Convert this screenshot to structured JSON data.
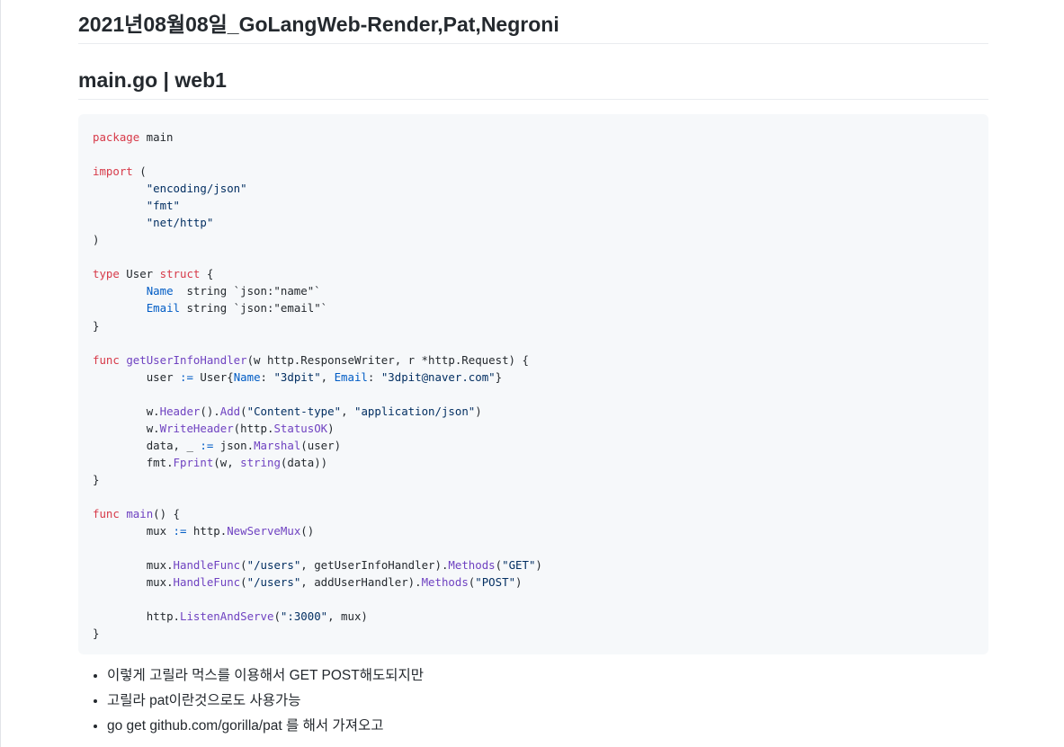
{
  "document": {
    "title": "2021년08월08일_GoLangWeb-Render,Pat,Negroni",
    "section_title": "main.go | web1"
  },
  "code": {
    "language": "go",
    "lines": [
      [
        {
          "t": "package",
          "c": "kw"
        },
        {
          "t": " main"
        }
      ],
      [],
      [
        {
          "t": "import",
          "c": "kw"
        },
        {
          "t": " ("
        }
      ],
      [
        {
          "t": "\t\"encoding/json\"",
          "c": "str"
        }
      ],
      [
        {
          "t": "\t\"fmt\"",
          "c": "str"
        }
      ],
      [
        {
          "t": "\t\"net/http\"",
          "c": "str"
        }
      ],
      [
        {
          "t": ")"
        }
      ],
      [],
      [
        {
          "t": "type",
          "c": "kw"
        },
        {
          "t": " User "
        },
        {
          "t": "struct",
          "c": "kw"
        },
        {
          "t": " {"
        }
      ],
      [
        {
          "t": "\t"
        },
        {
          "t": "Name",
          "c": "field"
        },
        {
          "t": "  string `json:\"name\"`"
        }
      ],
      [
        {
          "t": "\t"
        },
        {
          "t": "Email",
          "c": "field"
        },
        {
          "t": " string `json:\"email\"`"
        }
      ],
      [
        {
          "t": "}"
        }
      ],
      [],
      [
        {
          "t": "func",
          "c": "kw"
        },
        {
          "t": " "
        },
        {
          "t": "getUserInfoHandler",
          "c": "fn"
        },
        {
          "t": "(w http.ResponseWriter, r *http.Request) {"
        }
      ],
      [
        {
          "t": "\tuser "
        },
        {
          "t": ":=",
          "c": "op"
        },
        {
          "t": " User{"
        },
        {
          "t": "Name",
          "c": "field"
        },
        {
          "t": ": "
        },
        {
          "t": "\"3dpit\"",
          "c": "str"
        },
        {
          "t": ", "
        },
        {
          "t": "Email",
          "c": "field"
        },
        {
          "t": ": "
        },
        {
          "t": "\"3dpit@naver.com\"",
          "c": "str"
        },
        {
          "t": "}"
        }
      ],
      [],
      [
        {
          "t": "\tw."
        },
        {
          "t": "Header",
          "c": "fn"
        },
        {
          "t": "()."
        },
        {
          "t": "Add",
          "c": "fn"
        },
        {
          "t": "("
        },
        {
          "t": "\"Content-type\"",
          "c": "str"
        },
        {
          "t": ", "
        },
        {
          "t": "\"application/json\"",
          "c": "str"
        },
        {
          "t": ")"
        }
      ],
      [
        {
          "t": "\tw."
        },
        {
          "t": "WriteHeader",
          "c": "fn"
        },
        {
          "t": "(http."
        },
        {
          "t": "StatusOK",
          "c": "fn"
        },
        {
          "t": ")"
        }
      ],
      [
        {
          "t": "\tdata, _ "
        },
        {
          "t": ":=",
          "c": "op"
        },
        {
          "t": " json."
        },
        {
          "t": "Marshal",
          "c": "fn"
        },
        {
          "t": "(user)"
        }
      ],
      [
        {
          "t": "\tfmt."
        },
        {
          "t": "Fprint",
          "c": "fn"
        },
        {
          "t": "(w, "
        },
        {
          "t": "string",
          "c": "fn"
        },
        {
          "t": "(data))"
        }
      ],
      [
        {
          "t": "}"
        }
      ],
      [],
      [
        {
          "t": "func",
          "c": "kw"
        },
        {
          "t": " "
        },
        {
          "t": "main",
          "c": "fn"
        },
        {
          "t": "() {"
        }
      ],
      [
        {
          "t": "\tmux "
        },
        {
          "t": ":=",
          "c": "op"
        },
        {
          "t": " http."
        },
        {
          "t": "NewServeMux",
          "c": "fn"
        },
        {
          "t": "()"
        }
      ],
      [],
      [
        {
          "t": "\tmux."
        },
        {
          "t": "HandleFunc",
          "c": "fn"
        },
        {
          "t": "("
        },
        {
          "t": "\"/users\"",
          "c": "str"
        },
        {
          "t": ", getUserInfoHandler)."
        },
        {
          "t": "Methods",
          "c": "fn"
        },
        {
          "t": "("
        },
        {
          "t": "\"GET\"",
          "c": "str"
        },
        {
          "t": ")"
        }
      ],
      [
        {
          "t": "\tmux."
        },
        {
          "t": "HandleFunc",
          "c": "fn"
        },
        {
          "t": "("
        },
        {
          "t": "\"/users\"",
          "c": "str"
        },
        {
          "t": ", addUserHandler)."
        },
        {
          "t": "Methods",
          "c": "fn"
        },
        {
          "t": "("
        },
        {
          "t": "\"POST\"",
          "c": "str"
        },
        {
          "t": ")"
        }
      ],
      [],
      [
        {
          "t": "\thttp."
        },
        {
          "t": "ListenAndServe",
          "c": "fn"
        },
        {
          "t": "("
        },
        {
          "t": "\":3000\"",
          "c": "str"
        },
        {
          "t": ", mux)"
        }
      ],
      [
        {
          "t": "}"
        }
      ]
    ]
  },
  "notes": [
    "이렇게 고릴라 먹스를 이용해서 GET POST해도되지만",
    "고릴라 pat이란것으로도 사용가능",
    "go get github.com/gorilla/pat 를 해서 가져오고"
  ]
}
